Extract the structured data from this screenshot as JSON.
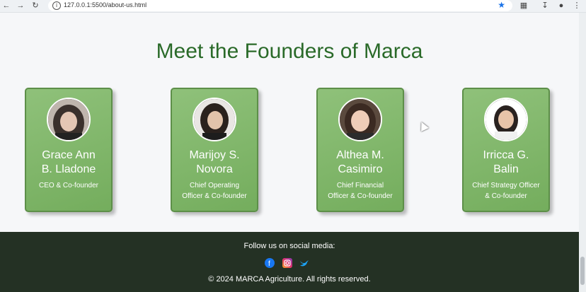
{
  "browser": {
    "url": "127.0.0.1:5500/about-us.html"
  },
  "page": {
    "heading": "Meet the Founders of Marca",
    "founders": [
      {
        "name_line1": "Grace Ann",
        "name_line2": "B. Lladone",
        "role_line1": "CEO & Co-founder",
        "role_line2": ""
      },
      {
        "name_line1": "Marijoy S.",
        "name_line2": "Novora",
        "role_line1": "Chief Operating",
        "role_line2": "Officer & Co-founder"
      },
      {
        "name_line1": "Althea M.",
        "name_line2": "Casimiro",
        "role_line1": "Chief Financial",
        "role_line2": "Officer & Co-founder"
      },
      {
        "name_line1": "Irricca G.",
        "name_line2": "Balin",
        "role_line1": "Chief Strategy Officer",
        "role_line2": "& Co-founder"
      }
    ]
  },
  "footer": {
    "follow_text": "Follow us on social media:",
    "copyright": "© 2024 MARCA Agriculture. All rights reserved.",
    "social_icons": [
      "facebook-icon",
      "instagram-icon",
      "twitter-icon"
    ]
  },
  "colors": {
    "heading": "#2a6a29",
    "card": "#7fb768",
    "footer": "#243124"
  }
}
